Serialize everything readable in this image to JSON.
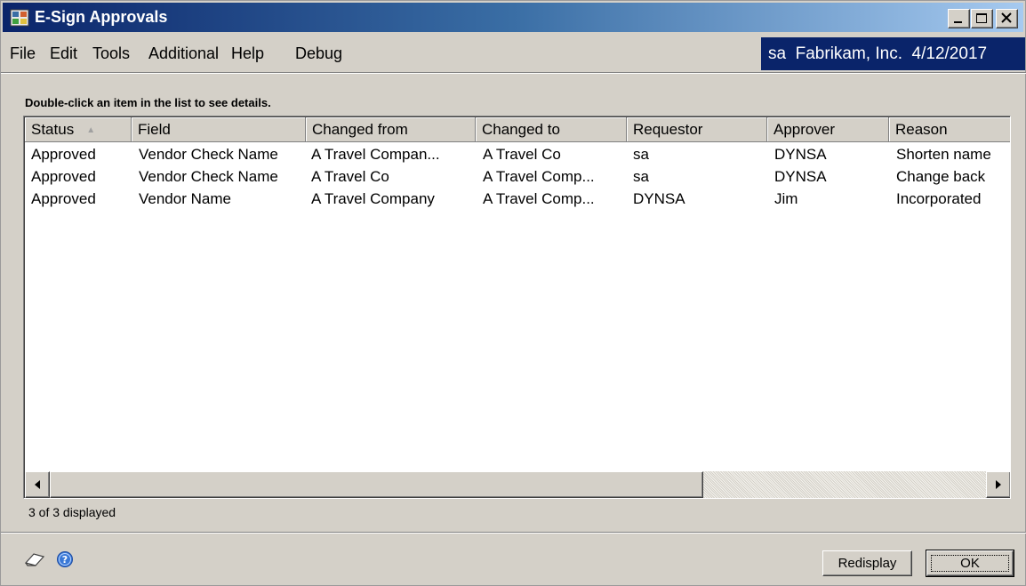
{
  "window": {
    "title": "E-Sign Approvals",
    "title_bar_colors": [
      "#0a246a",
      "#a6caf0"
    ]
  },
  "title_buttons": [
    "minimize-icon",
    "maximize-icon",
    "close-icon"
  ],
  "menu": {
    "items": [
      "File",
      "Edit",
      "Tools",
      "Additional",
      "Help",
      "Debug"
    ],
    "user_info": "sa  Fabrikam, Inc.  4/12/2017"
  },
  "instruction": "Double-click an item in the list to see details.",
  "list": {
    "columns": [
      "Status",
      "Field",
      "Changed from",
      "Changed to",
      "Requestor",
      "Approver",
      "Reason"
    ],
    "sort_column": "Status",
    "sort_direction": "ascending",
    "rows": [
      [
        "Approved",
        "Vendor Check Name",
        "A Travel Compan...",
        "A Travel Co",
        "sa",
        "DYNSA",
        "Shorten name"
      ],
      [
        "Approved",
        "Vendor Check Name",
        "A Travel Co",
        "A Travel Comp...",
        "sa",
        "DYNSA",
        "Change back"
      ],
      [
        "Approved",
        "Vendor Name",
        "A Travel Company",
        "A Travel Comp...",
        "DYNSA",
        "Jim",
        "Incorporated"
      ]
    ]
  },
  "status": {
    "count_text": "3 of 3 displayed"
  },
  "footer": {
    "icons": [
      "note-icon",
      "help-icon"
    ],
    "redisplay_label": "Redisplay",
    "ok_label": "OK"
  }
}
